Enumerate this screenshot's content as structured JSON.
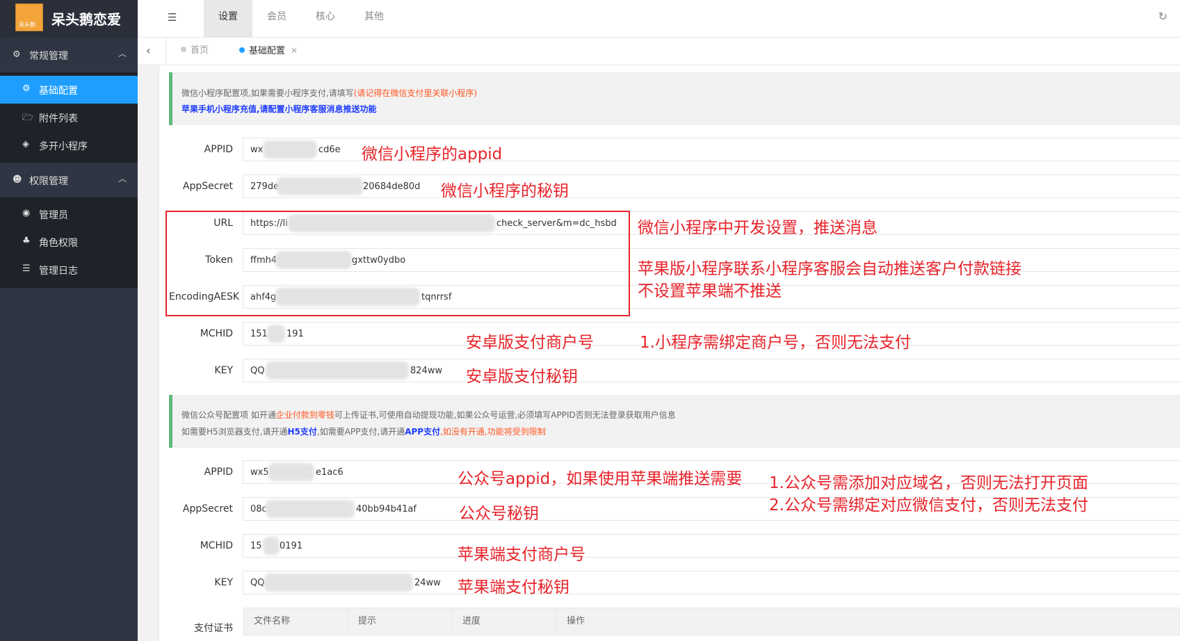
{
  "brand": {
    "name": "呆头鹅恋爱",
    "logo_text": "呆头鹅"
  },
  "sidebar": {
    "group1": {
      "label": "常规管理",
      "icon": "gear-icon"
    },
    "items1": [
      {
        "label": "基础配置",
        "icon": "gear-icon"
      },
      {
        "label": "附件列表",
        "icon": "folder-icon"
      },
      {
        "label": "多开小程序",
        "icon": "cube-icon"
      }
    ],
    "group2": {
      "label": "权限管理",
      "icon": "group-icon"
    },
    "items2": [
      {
        "label": "管理员",
        "icon": "user-circle-icon"
      },
      {
        "label": "角色权限",
        "icon": "sitemap-icon"
      },
      {
        "label": "管理日志",
        "icon": "list-icon"
      }
    ]
  },
  "header": {
    "tabs": [
      "设置",
      "会员",
      "核心",
      "其他"
    ]
  },
  "pagetabs": {
    "home": "首页",
    "current": "基础配置"
  },
  "notice1": {
    "text": "微信小程序配置项,如果需要小程序支付,请填写",
    "red": "(请记得在微信支付里关联小程序)",
    "blue": "苹果手机小程序充值,请配置小程序客服消息推送功能"
  },
  "mini": {
    "appid": {
      "label": "APPID",
      "pre": "wx",
      "post": "cd6e"
    },
    "secret": {
      "label": "AppSecret",
      "pre": "279de",
      "post": "20684de80d"
    },
    "url": {
      "label": "URL",
      "pre": "https://li",
      "post": "check_server&m=dc_hsbd"
    },
    "token": {
      "label": "Token",
      "pre": "ffmh4",
      "post": "gxttw0ydbo"
    },
    "aes": {
      "label": "EncodingAESK",
      "pre": "ahf4g",
      "post": "tqnrrsf"
    },
    "mchid": {
      "label": "MCHID",
      "pre": "151",
      "post": "191"
    },
    "key": {
      "label": "KEY",
      "pre": "QQ",
      "post": "824ww"
    }
  },
  "notice2": {
    "l1a": "微信公众号配置项 如开通",
    "l1red": "企业付款到零钱",
    "l1b": "可上传证书,可使用自动提现功能,如果公众号运营,必须填写APPID否则无法登录获取用户信息",
    "l2a": "如需要H5浏览器支付,请开通",
    "l2blue1": "H5支付",
    "l2b": ",如需要APP支付,请开通",
    "l2blue2": "APP支付",
    "l2red": ",如没有开通,功能将受到限制"
  },
  "mp": {
    "appid": {
      "label": "APPID",
      "pre": "wx5",
      "post": "e1ac6"
    },
    "secret": {
      "label": "AppSecret",
      "pre": "08c",
      "post": "40bb94b41af"
    },
    "mchid": {
      "label": "MCHID",
      "pre": "15",
      "post": "0191"
    },
    "key": {
      "label": "KEY",
      "pre": "QQ",
      "post": "24ww"
    }
  },
  "cert": {
    "label": "支付证书",
    "cols": [
      "文件名称",
      "提示",
      "进度",
      "操作"
    ]
  },
  "annotations": {
    "a1": "微信小程序的appid",
    "a2": "微信小程序的秘钥",
    "a3": "微信小程序中开发设置，推送消息",
    "a4": "苹果版小程序联系小程序客服会自动推送客户付款链接",
    "a5": "不设置苹果端不推送",
    "a6": "安卓版支付商户号",
    "a7": "1.小程序需绑定商户号，否则无法支付",
    "a8": "安卓版支付秘钥",
    "a9": "公众号appid，如果使用苹果端推送需要",
    "a10": "1.公众号需添加对应域名，否则无法打开页面",
    "a11": "2.公众号需绑定对应微信支付，否则无法支付",
    "a12": "公众号秘钥",
    "a13": "苹果端支付商户号",
    "a14": "苹果端支付秘钥"
  },
  "colors": {
    "accent": "#1e9fff",
    "sidebar": "#2f3542",
    "annotation": "#e8232a"
  }
}
